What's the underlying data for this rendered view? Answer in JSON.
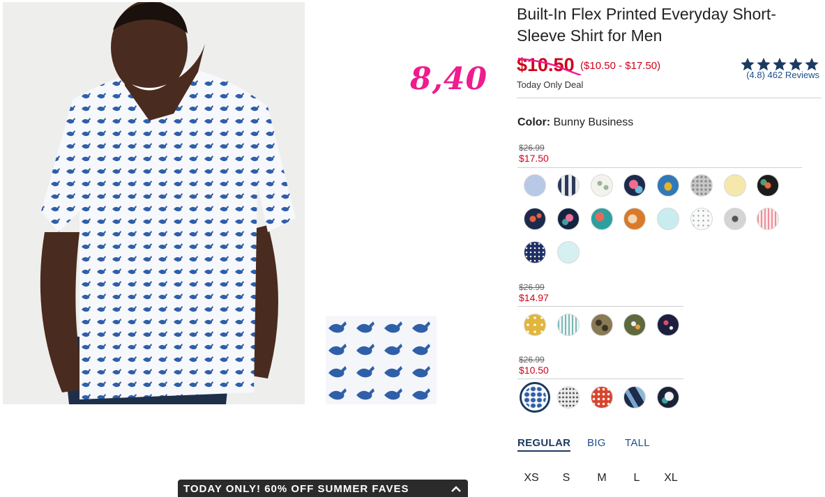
{
  "annotation": {
    "handwritten_price": "8,40"
  },
  "product": {
    "title": "Built-In Flex Printed Everyday Short-Sleeve Shirt for Men",
    "sale_price": "$10.50",
    "price_range": "($10.50 - $17.50)",
    "deal_label": "Today Only Deal",
    "rating_value": 4.8,
    "rating_text": "(4.8) 462 Reviews"
  },
  "color": {
    "label": "Color:",
    "value": "Bunny Business",
    "groups": [
      {
        "old_price": "$26.99",
        "new_price": "$17.50"
      },
      {
        "old_price": "$26.99",
        "new_price": "$14.97"
      },
      {
        "old_price": "$26.99",
        "new_price": "$10.50"
      }
    ]
  },
  "fit": {
    "tabs": [
      "REGULAR",
      "BIG",
      "TALL"
    ],
    "active": "REGULAR"
  },
  "sizes": [
    "XS",
    "S",
    "M",
    "L",
    "XL"
  ],
  "promo": {
    "text": "TODAY ONLY! 60% OFF SUMMER FAVES"
  },
  "colors": {
    "accent": "#d0021b",
    "navy": "#1b3a5f",
    "link": "#1b4e8c",
    "annotation": "#ee1c8d"
  }
}
